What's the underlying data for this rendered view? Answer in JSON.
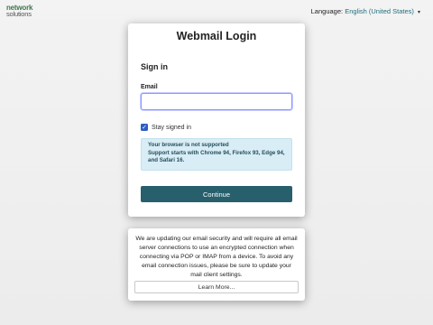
{
  "brand": {
    "line1": "network",
    "line2": "solutions"
  },
  "language": {
    "label": "Language:",
    "value": "English (United States)",
    "caret": "▾"
  },
  "login": {
    "title": "Webmail Login",
    "heading": "Sign in",
    "email_label": "Email",
    "email_value": "",
    "email_placeholder": "",
    "stay_signed_in": "Stay signed in",
    "stay_checked": true,
    "warning_line1": "Your browser is not supported",
    "warning_line2": "Support starts with Chrome 94, Firefox 93, Edge 94, and Safari 16.",
    "continue_label": "Continue"
  },
  "notice": {
    "text": "We are updating our email security and will require all email server connections to use an encrypted connection when connecting via POP or IMAP from a device. To avoid any email connection issues, please be sure to update your mail client settings.",
    "learn_more": "Learn More..."
  },
  "colors": {
    "accent": "#275f6d",
    "brand_green": "#3d7a4a",
    "link": "#1f6f7e",
    "warning_bg": "#d8edf5"
  }
}
